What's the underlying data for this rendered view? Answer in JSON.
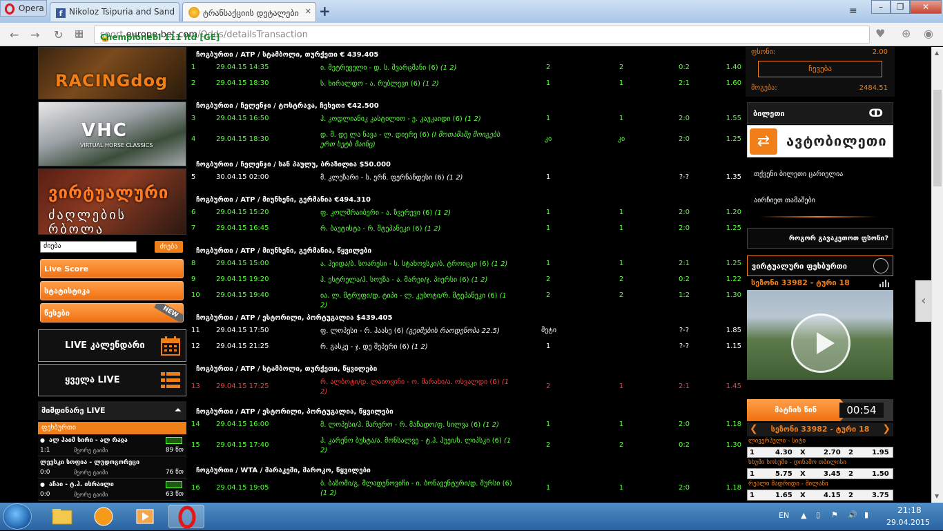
{
  "browser": {
    "menu_label": "Opera",
    "tabs": [
      {
        "label": "Nikoloz Tsipuria and Sand"
      },
      {
        "label": "ტრანსაქციის დეტალები"
      }
    ],
    "url_secure": "Chempionebi 111 ltd [GE]",
    "url_prefix": "sport.",
    "url_domain": "europe-bet.com",
    "url_path": "/Odds/detailsTransaction"
  },
  "left": {
    "banner1": {
      "word1": "RACING",
      "word2": "dog"
    },
    "banner2": {
      "title": "VHC",
      "subtitle": "VIRTUAL HORSE CLASSICS"
    },
    "banner3": {
      "line1": "ვირტუალური",
      "line2": "ძაღლების რბოლა"
    },
    "search_value": "ძიება",
    "search_button": "ძიება",
    "buttons": [
      "Live Score",
      "სტატისტიკა",
      "წესები"
    ],
    "new_tag": "NEW",
    "live_calendar": "LIVE კალენდარი",
    "all_live": "ყველა LIVE",
    "current_live_title": "მიმდინარე LIVE",
    "sport_label": "ფეხბურთი",
    "live_rows": [
      {
        "names": "ალ ჰაიმ სირი - ალ რაჲა",
        "score": "1:1",
        "status": "მეორე ტაიმი",
        "minute": "89 წთ"
      },
      {
        "names": "ლევსკი სოფია - ლუდოგორეცი",
        "score": "0:0",
        "status": "მეორე ტაიმი",
        "minute": "76 წთ"
      },
      {
        "names": "აჩაი - ტ.ჰ. ისრაილი",
        "score": "0:0",
        "status": "მეორე ტაიმი",
        "minute": "63 წთ"
      }
    ]
  },
  "main": {
    "sections": [
      {
        "title": "ჩოგბურთი / ATP / სტამბოლი, თურქეთი € 439.405",
        "rows": [
          {
            "n": "1",
            "date": "29.04.15 14:35",
            "event": "ი. მეტრეველი - დ. ს. შვარცმანი",
            "pick": "(6)",
            "odds_note": "(1 2)",
            "bet": "2",
            "res": "2",
            "score": "0:2",
            "odd": "1.40",
            "color": "green"
          },
          {
            "n": "2",
            "date": "29.04.15 18:30",
            "event": "ს. ხირალდო - ა. რუბლევი",
            "pick": "(6)",
            "odds_note": "(1 2)",
            "bet": "1",
            "res": "1",
            "score": "2:1",
            "odd": "1.60",
            "color": "green"
          }
        ]
      },
      {
        "title": "ჩოგბურთი / ჩელენჯი / ტოსტრავა, ჩეხეთი €42.500",
        "rows": [
          {
            "n": "3",
            "date": "29.04.15 16:50",
            "event": "ჰ. კოდლიანიკ კასტილიო - ე. კაუკაიდი",
            "pick": "(6)",
            "odds_note": "(1 2)",
            "bet": "1",
            "res": "1",
            "score": "2:0",
            "odd": "1.55",
            "color": "green"
          },
          {
            "n": "4",
            "date": "29.04.15 18:30",
            "event": "დ. მ. დე ლა ნავა - ლ. დიერე",
            "pick": "(6)",
            "odds_note": "(I მოთამაშე მოიგებს ერთ სეტს მაინც)",
            "bet": "კი",
            "res": "კი",
            "score": "2:0",
            "odd": "1.25",
            "color": "green"
          }
        ]
      },
      {
        "title": "ჩოგბურთი / ჩელენჯი / სან პაულუ, ბრაზილია $50.000",
        "rows": [
          {
            "n": "5",
            "date": "30.04.15 02:00",
            "event": "მ. კლეზარი - ს. ერნ. ფერნანდესი",
            "pick": "(6)",
            "odds_note": "(1 2)",
            "bet": "1",
            "res": "",
            "score": "?-?",
            "odd": "1.35",
            "color": "white"
          }
        ]
      },
      {
        "title": "ჩოგბურთი / ATP / მიუნხენი, გერმანია €494.310",
        "rows": [
          {
            "n": "6",
            "date": "29.04.15 15:20",
            "event": "ფ. კოლშრაიბერი - ა. ზვერევი",
            "pick": "(6)",
            "odds_note": "(1 2)",
            "bet": "1",
            "res": "1",
            "score": "2:0",
            "odd": "1.20",
            "color": "green"
          },
          {
            "n": "7",
            "date": "29.04.15 16:45",
            "event": "რ. ბაუტისტა - რ. შტეპანეკი",
            "pick": "(6)",
            "odds_note": "(1 2)",
            "bet": "1",
            "res": "1",
            "score": "2:0",
            "odd": "1.25",
            "color": "green"
          }
        ]
      },
      {
        "title": "ჩოგბურთი / ATP / მიუნხენი, გერმანია, წყვილები",
        "rows": [
          {
            "n": "8",
            "date": "29.04.15 15:00",
            "event": "ა. ჰეიდა/ბ. სოარესი - ს. სტახოვსკი/ბ. ტროიცკი",
            "pick": "(6)",
            "odds_note": "(1 2)",
            "bet": "1",
            "res": "1",
            "score": "2:1",
            "odd": "1.25",
            "color": "green"
          },
          {
            "n": "9",
            "date": "29.04.15 19:20",
            "event": "ჰ. ესტრელა/ჰ. სოუზა - ა. მარეი/ჯ. პიერსი",
            "pick": "(6)",
            "odds_note": "(1 2)",
            "bet": "2",
            "res": "2",
            "score": "0:2",
            "odd": "1.22",
            "color": "green"
          },
          {
            "n": "10",
            "date": "29.04.15 19:40",
            "event": "ია. ლ. შტრუფი/დ. ტიპი - ლ. კუბოტი/რ. შტეპანეკი",
            "pick": "(6)",
            "odds_note": "(1 2)",
            "bet": "2",
            "res": "2",
            "score": "1:2",
            "odd": "1.30",
            "color": "green"
          }
        ]
      },
      {
        "title": "ჩოგბურთი / ATP / ესტორილი, პორტუგალია $439.405",
        "rows": [
          {
            "n": "11",
            "date": "29.04.15 17:50",
            "event": "ფ. ლოპესი - რ. ჰაასე",
            "pick": "(6)",
            "odds_note": "(გეიმების რაოდენობა 22.5)",
            "bet": "მეტი",
            "res": "",
            "score": "?-?",
            "odd": "1.85",
            "color": "white"
          },
          {
            "n": "12",
            "date": "29.04.15 21:25",
            "event": "რ. გასკე - ჯ. დე შეპერი",
            "pick": "(6)",
            "odds_note": "(1 2)",
            "bet": "1",
            "res": "",
            "score": "?-?",
            "odd": "1.15",
            "color": "white"
          }
        ]
      },
      {
        "title": "ჩოგბურთი / ATP / სტამბოლი, თურქეთი, წყვილები",
        "rows": [
          {
            "n": "13",
            "date": "29.04.15 17:25",
            "event": "რ. ალბოტი/დ. ლაიოვიჩი - ო. მარახი/ა. ოსვალდი",
            "pick": "(6)",
            "odds_note": "(1 2)",
            "bet": "2",
            "res": "1",
            "score": "2:1",
            "odd": "1.45",
            "color": "red"
          }
        ]
      },
      {
        "title": "ჩოგბურთი / ATP / ესტორილი, პორტუგალია, წყვილები",
        "rows": [
          {
            "n": "14",
            "date": "29.04.15 16:00",
            "event": "მ. ლოპესი/ჰ. მარერო - რ. მაჩადო/ფ. სილვა",
            "pick": "(6)",
            "odds_note": "(1 2)",
            "bet": "1",
            "res": "1",
            "score": "2:0",
            "odd": "1.18",
            "color": "green"
          },
          {
            "n": "15",
            "date": "29.04.15 17:40",
            "event": "ჰ. კარენო ბუსტა/ა. მონსალვე - ტ.ჰ. ჰუეი/ს. ლიპსკი",
            "pick": "(6)",
            "odds_note": "(1 2)",
            "bet": "2",
            "res": "2",
            "score": "0:2",
            "odd": "1.30",
            "color": "green"
          }
        ]
      },
      {
        "title": "ჩოგბურთი / WTA / მარაკეში, მაროკო, წყვილები",
        "rows": [
          {
            "n": "16",
            "date": "29.04.15 19:05",
            "event": "ბ. ბაზომი/გ. მლადენოვიჩი - ი. ბონავენტური/დ. შურსი",
            "pick": "(6)",
            "odds_note": "(1 2)",
            "bet": "1",
            "res": "1",
            "score": "2:0",
            "odd": "1.18",
            "color": "green"
          }
        ]
      }
    ]
  },
  "right": {
    "factor_label": "ფსონი:",
    "factor_value": "2.00",
    "choose_button": "ჩევება",
    "win_label": "მოგება:",
    "win_value": "2484.51",
    "ticket_label": "ბილეთი",
    "autobet": "ავტობილეთი",
    "ticket_empty": "თქვენი ბილეთი ცარიელია",
    "quick_games": "აირჩიეთ თამაშები",
    "how_to_bet": "როგორ გავაკეთოთ ფსონი?",
    "virtual_football": "ვირტუალური ფეხბურთი",
    "season_round": "სეზონი 33982 - ტური 18",
    "before_match": "მატჩის წინ",
    "timer": "00:54",
    "matches": [
      {
        "name": "ლივერპული - სიტი",
        "o1": "4.30",
        "ox": "2.70",
        "o2": "1.95"
      },
      {
        "name": "ხხუმი სოსუმი - დინამო თბილისი",
        "o1": "5.75",
        "ox": "3.45",
        "o2": "1.50"
      },
      {
        "name": "რეალი მადრიდი - მილანი",
        "o1": "1.65",
        "ox": "4.15",
        "o2": "3.75"
      }
    ]
  },
  "taskbar": {
    "lang": "EN",
    "time": "21:18",
    "date": "29.04.2015"
  }
}
